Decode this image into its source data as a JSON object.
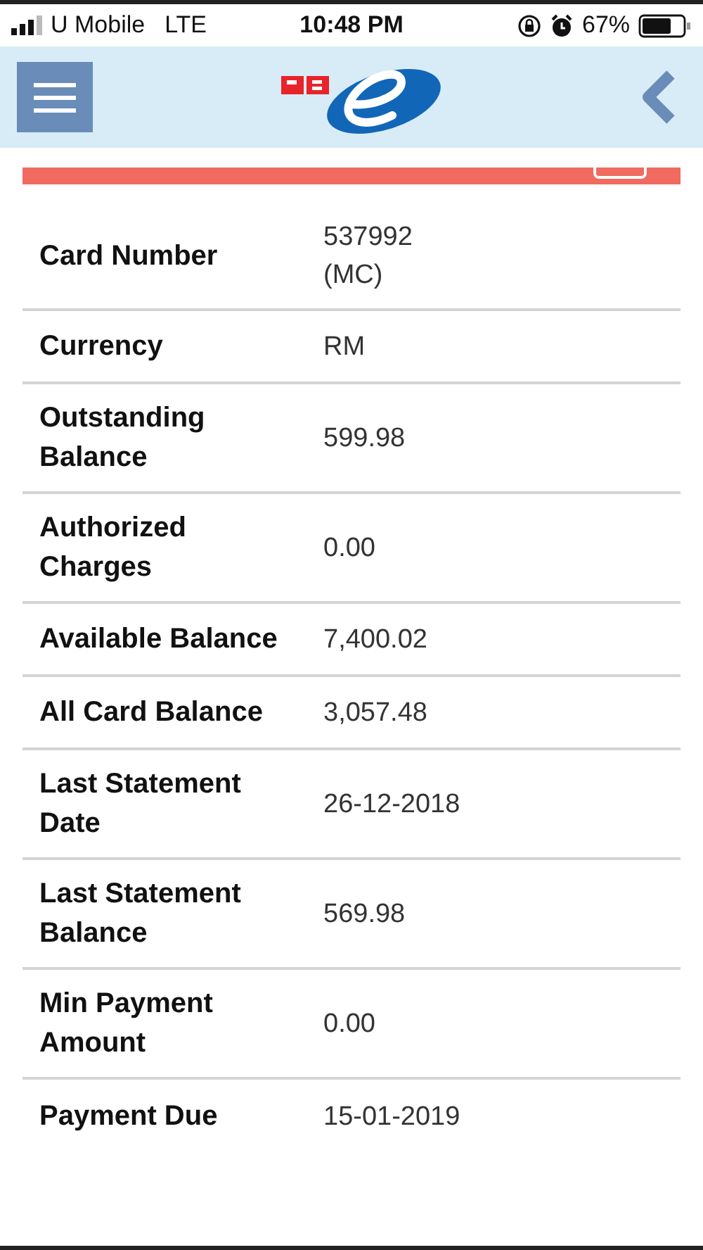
{
  "status_bar": {
    "carrier": "U Mobile",
    "network": "LTE",
    "time": "10:48 PM",
    "battery": "67%"
  },
  "rows": [
    {
      "label": "Card Number",
      "value": "537992\n(MC)"
    },
    {
      "label": "Currency",
      "value": "RM"
    },
    {
      "label": "Outstanding Balance",
      "value": "599.98"
    },
    {
      "label": "Authorized Charges",
      "value": "0.00"
    },
    {
      "label": "Available Balance",
      "value": "7,400.02"
    },
    {
      "label": "All Card Balance",
      "value": "3,057.48"
    },
    {
      "label": "Last Statement Date",
      "value": "26-12-2018"
    },
    {
      "label": "Last Statement Balance",
      "value": "569.98"
    },
    {
      "label": "Min Payment Amount",
      "value": "0.00"
    },
    {
      "label": "Payment Due",
      "value": "15-01-2019"
    }
  ]
}
